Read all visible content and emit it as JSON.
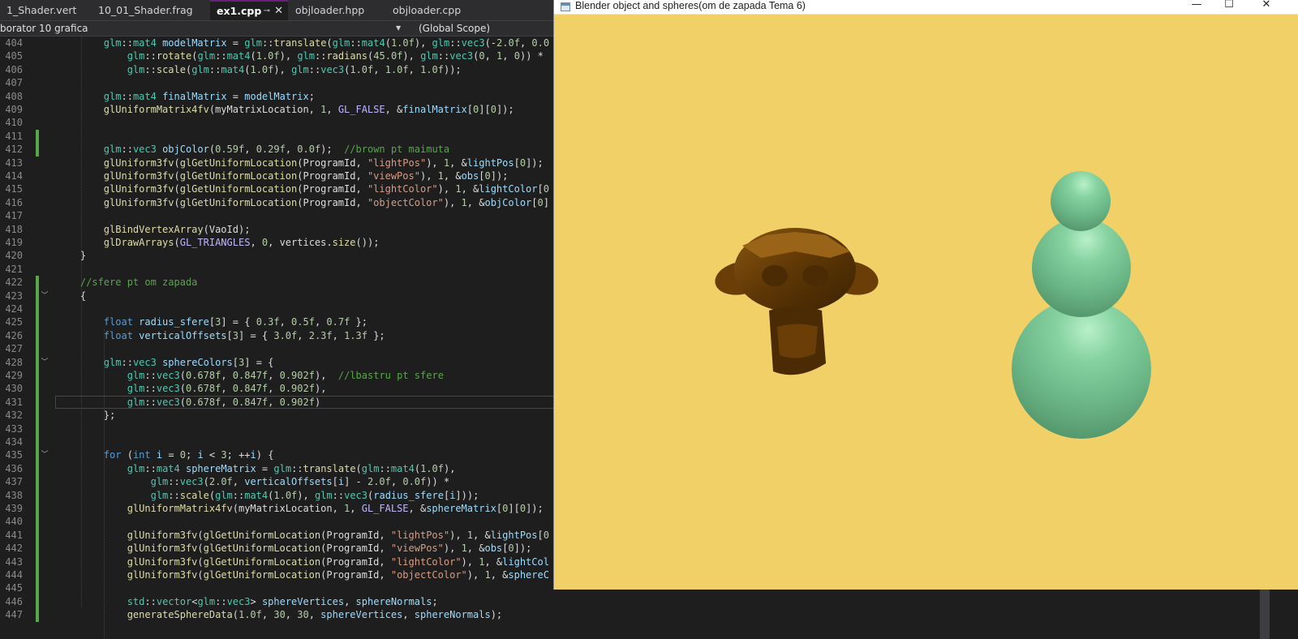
{
  "tabs": [
    {
      "label": "1_Shader.vert",
      "active": false
    },
    {
      "label": "10_01_Shader.frag",
      "active": false
    },
    {
      "label": "ex1.cpp",
      "active": true
    },
    {
      "label": "objloader.hpp",
      "active": false
    },
    {
      "label": "objloader.cpp",
      "active": false
    }
  ],
  "tab_icons": {
    "pin": "⊸",
    "close": "✕"
  },
  "navbar": {
    "project": "borator 10 grafica",
    "scope": "(Global Scope)"
  },
  "code_lines": [
    {
      "num": "404",
      "html": "        <span class='t'>glm</span>::<span class='t'>mat4</span> <span class='v'>modelMatrix</span> = <span class='t'>glm</span>::<span class='f'>translate</span>(<span class='t'>glm</span>::<span class='t'>mat4</span>(<span class='n'>1.0f</span>), <span class='t'>glm</span>::<span class='t'>vec3</span>(-<span class='n'>2.0f</span>, <span class='n'>0.0</span>"
    },
    {
      "num": "405",
      "html": "            <span class='t'>glm</span>::<span class='f'>rotate</span>(<span class='t'>glm</span>::<span class='t'>mat4</span>(<span class='n'>1.0f</span>), <span class='t'>glm</span>::<span class='f'>radians</span>(<span class='n'>45.0f</span>), <span class='t'>glm</span>::<span class='t'>vec3</span>(<span class='n'>0</span>, <span class='n'>1</span>, <span class='n'>0</span>)) *"
    },
    {
      "num": "406",
      "html": "            <span class='t'>glm</span>::<span class='f'>scale</span>(<span class='t'>glm</span>::<span class='t'>mat4</span>(<span class='n'>1.0f</span>), <span class='t'>glm</span>::<span class='t'>vec3</span>(<span class='n'>1.0f</span>, <span class='n'>1.0f</span>, <span class='n'>1.0f</span>));"
    },
    {
      "num": "407",
      "html": ""
    },
    {
      "num": "408",
      "html": "        <span class='t'>glm</span>::<span class='t'>mat4</span> <span class='v'>finalMatrix</span> = <span class='v'>modelMatrix</span>;"
    },
    {
      "num": "409",
      "html": "        <span class='f'>glUniformMatrix4fv</span>(myMatrixLocation, <span class='n'>1</span>, <span class='m'>GL_FALSE</span>, &amp;<span class='v'>finalMatrix</span>[<span class='n'>0</span>][<span class='n'>0</span>]);"
    },
    {
      "num": "410",
      "html": ""
    },
    {
      "num": "411",
      "html": ""
    },
    {
      "num": "412",
      "html": "        <span class='t'>glm</span>::<span class='t'>vec3</span> <span class='v'>objColor</span>(<span class='n'>0.59f</span>, <span class='n'>0.29f</span>, <span class='n'>0.0f</span>);  <span class='c'>//brown pt maimuta</span>"
    },
    {
      "num": "413",
      "html": "        <span class='f'>glUniform3fv</span>(<span class='f'>glGetUniformLocation</span>(ProgramId, <span class='s'>\"lightPos\"</span>), <span class='n'>1</span>, &amp;<span class='v'>lightPos</span>[<span class='n'>0</span>]);"
    },
    {
      "num": "414",
      "html": "        <span class='f'>glUniform3fv</span>(<span class='f'>glGetUniformLocation</span>(ProgramId, <span class='s'>\"viewPos\"</span>), <span class='n'>1</span>, &amp;<span class='v'>obs</span>[<span class='n'>0</span>]);"
    },
    {
      "num": "415",
      "html": "        <span class='f'>glUniform3fv</span>(<span class='f'>glGetUniformLocation</span>(ProgramId, <span class='s'>\"lightColor\"</span>), <span class='n'>1</span>, &amp;<span class='v'>lightColor</span>[<span class='n'>0</span>"
    },
    {
      "num": "416",
      "html": "        <span class='f'>glUniform3fv</span>(<span class='f'>glGetUniformLocation</span>(ProgramId, <span class='s'>\"objectColor\"</span>), <span class='n'>1</span>, &amp;<span class='v'>objColor</span>[<span class='n'>0</span>]"
    },
    {
      "num": "417",
      "html": ""
    },
    {
      "num": "418",
      "html": "        <span class='f'>glBindVertexArray</span>(VaoId);"
    },
    {
      "num": "419",
      "html": "        <span class='f'>glDrawArrays</span>(<span class='m'>GL_TRIANGLES</span>, <span class='n'>0</span>, vertices.<span class='f'>size</span>());"
    },
    {
      "num": "420",
      "html": "    }"
    },
    {
      "num": "421",
      "html": ""
    },
    {
      "num": "422",
      "html": "    <span class='c'>//sfere pt om zapada</span>"
    },
    {
      "num": "423",
      "html": "    {"
    },
    {
      "num": "424",
      "html": ""
    },
    {
      "num": "425",
      "html": "        <span class='k'>float</span> <span class='v'>radius_sfere</span>[<span class='n'>3</span>] = { <span class='n'>0.3f</span>, <span class='n'>0.5f</span>, <span class='n'>0.7f</span> };"
    },
    {
      "num": "426",
      "html": "        <span class='k'>float</span> <span class='v'>verticalOffsets</span>[<span class='n'>3</span>] = { <span class='n'>3.0f</span>, <span class='n'>2.3f</span>, <span class='n'>1.3f</span> };"
    },
    {
      "num": "427",
      "html": ""
    },
    {
      "num": "428",
      "html": "        <span class='t'>glm</span>::<span class='t'>vec3</span> <span class='v'>sphereColors</span>[<span class='n'>3</span>] = {"
    },
    {
      "num": "429",
      "html": "            <span class='t'>glm</span>::<span class='t'>vec3</span>(<span class='n'>0.678f</span>, <span class='n'>0.847f</span>, <span class='n'>0.902f</span>),  <span class='c'>//lbastru pt sfere</span>"
    },
    {
      "num": "430",
      "html": "            <span class='t'>glm</span>::<span class='t'>vec3</span>(<span class='n'>0.678f</span>, <span class='n'>0.847f</span>, <span class='n'>0.902f</span>),"
    },
    {
      "num": "431",
      "html": "            <span class='t'>glm</span>::<span class='t'>vec3</span>(<span class='n'>0.678f</span>, <span class='n'>0.847f</span>, <span class='n'>0.902f</span>)"
    },
    {
      "num": "432",
      "html": "        };"
    },
    {
      "num": "433",
      "html": ""
    },
    {
      "num": "434",
      "html": ""
    },
    {
      "num": "435",
      "html": "        <span class='k'>for</span> (<span class='k'>int</span> <span class='v'>i</span> = <span class='n'>0</span>; <span class='v'>i</span> &lt; <span class='n'>3</span>; ++<span class='v'>i</span>) {"
    },
    {
      "num": "436",
      "html": "            <span class='t'>glm</span>::<span class='t'>mat4</span> <span class='v'>sphereMatrix</span> = <span class='t'>glm</span>::<span class='f'>translate</span>(<span class='t'>glm</span>::<span class='t'>mat4</span>(<span class='n'>1.0f</span>),"
    },
    {
      "num": "437",
      "html": "                <span class='t'>glm</span>::<span class='t'>vec3</span>(<span class='n'>2.0f</span>, <span class='v'>verticalOffsets</span>[<span class='v'>i</span>] - <span class='n'>2.0f</span>, <span class='n'>0.0f</span>)) *"
    },
    {
      "num": "438",
      "html": "                <span class='t'>glm</span>::<span class='f'>scale</span>(<span class='t'>glm</span>::<span class='t'>mat4</span>(<span class='n'>1.0f</span>), <span class='t'>glm</span>::<span class='t'>vec3</span>(<span class='v'>radius_sfere</span>[<span class='v'>i</span>]));"
    },
    {
      "num": "439",
      "html": "            <span class='f'>glUniformMatrix4fv</span>(myMatrixLocation, <span class='n'>1</span>, <span class='m'>GL_FALSE</span>, &amp;<span class='v'>sphereMatrix</span>[<span class='n'>0</span>][<span class='n'>0</span>]);"
    },
    {
      "num": "440",
      "html": ""
    },
    {
      "num": "441",
      "html": "            <span class='f'>glUniform3fv</span>(<span class='f'>glGetUniformLocation</span>(ProgramId, <span class='s'>\"lightPos\"</span>), <span class='n'>1</span>, &amp;<span class='v'>lightPos</span>[<span class='n'>0</span>"
    },
    {
      "num": "442",
      "html": "            <span class='f'>glUniform3fv</span>(<span class='f'>glGetUniformLocation</span>(ProgramId, <span class='s'>\"viewPos\"</span>), <span class='n'>1</span>, &amp;<span class='v'>obs</span>[<span class='n'>0</span>]);"
    },
    {
      "num": "443",
      "html": "            <span class='f'>glUniform3fv</span>(<span class='f'>glGetUniformLocation</span>(ProgramId, <span class='s'>\"lightColor\"</span>), <span class='n'>1</span>, &amp;<span class='v'>lightCol</span>"
    },
    {
      "num": "444",
      "html": "            <span class='f'>glUniform3fv</span>(<span class='f'>glGetUniformLocation</span>(ProgramId, <span class='s'>\"objectColor\"</span>), <span class='n'>1</span>, &amp;<span class='v'>sphereC</span>"
    },
    {
      "num": "445",
      "html": ""
    },
    {
      "num": "446",
      "html": "            <span class='t'>std</span>::<span class='t'>vector</span>&lt;<span class='t'>glm</span>::<span class='t'>vec3</span>&gt; <span class='v'>sphereVertices</span>, <span class='v'>sphereNormals</span>;"
    },
    {
      "num": "447",
      "html": "            <span class='f'>generateSphereData</span>(<span class='n'>1.0f</span>, <span class='n'>30</span>, <span class='n'>30</span>, <span class='v'>sphereVertices</span>, <span class='v'>sphereNormals</span>);"
    }
  ],
  "changed_lines": [
    "411",
    "412",
    "422",
    "423",
    "424",
    "425",
    "426",
    "427",
    "428",
    "429",
    "430",
    "431",
    "432",
    "433",
    "434",
    "435",
    "436",
    "437",
    "438",
    "439",
    "440",
    "441",
    "442",
    "443",
    "444",
    "445",
    "446",
    "447"
  ],
  "fold_lines": [
    "423",
    "428",
    "435"
  ],
  "current_line": "431",
  "window": {
    "title": "Blender object and spheres(om de zapada Tema 6)",
    "icon": "app-window-icon",
    "controls": {
      "minimize": "—",
      "maximize": "☐",
      "close": "✕"
    }
  },
  "colors": {
    "editor_bg": "#1e1e1e",
    "scene_bg": "#f1d067",
    "monkey": "#6b3f07",
    "snowman": "#7cc79a",
    "changed_marker": "#57a64a"
  }
}
